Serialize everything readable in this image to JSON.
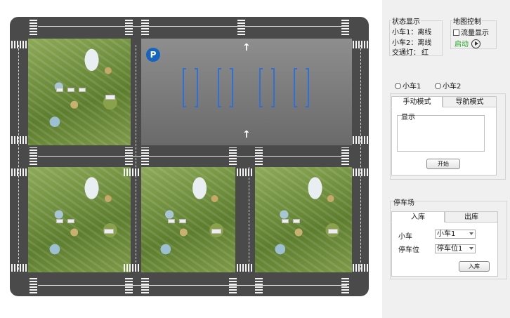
{
  "map": {
    "parking_icon": "P",
    "icons": [
      "parking-icon",
      "up-arrow-icon"
    ]
  },
  "status": {
    "title": "状态显示",
    "car1_label": "小车1：",
    "car1_value": "离线",
    "car2_label": "小车2：",
    "car2_value": "离线",
    "light_label": "交通灯：",
    "light_value": "红"
  },
  "map_control": {
    "title": "地图控制",
    "flow_display_label": "流量显示",
    "flow_display_checked": false,
    "start_label": "启动",
    "start_color": "#1fa81f"
  },
  "car_select": {
    "options": [
      "小车1",
      "小车2"
    ]
  },
  "mode_tabs": {
    "tabs": [
      "手动模式",
      "导航模式"
    ],
    "active": 0,
    "display_label": "显示",
    "start_button": "开始"
  },
  "parking": {
    "title": "停车场",
    "tabs": [
      "入库",
      "出库"
    ],
    "active": 0,
    "car_label": "小车",
    "car_value": "小车1",
    "slot_label": "停车位",
    "slot_value": "停车位1",
    "park_button": "入库"
  },
  "colors": {
    "slot_border": "#2f6fd6",
    "parking_icon_bg": "#1565c0",
    "road": "#4a4a4a"
  }
}
